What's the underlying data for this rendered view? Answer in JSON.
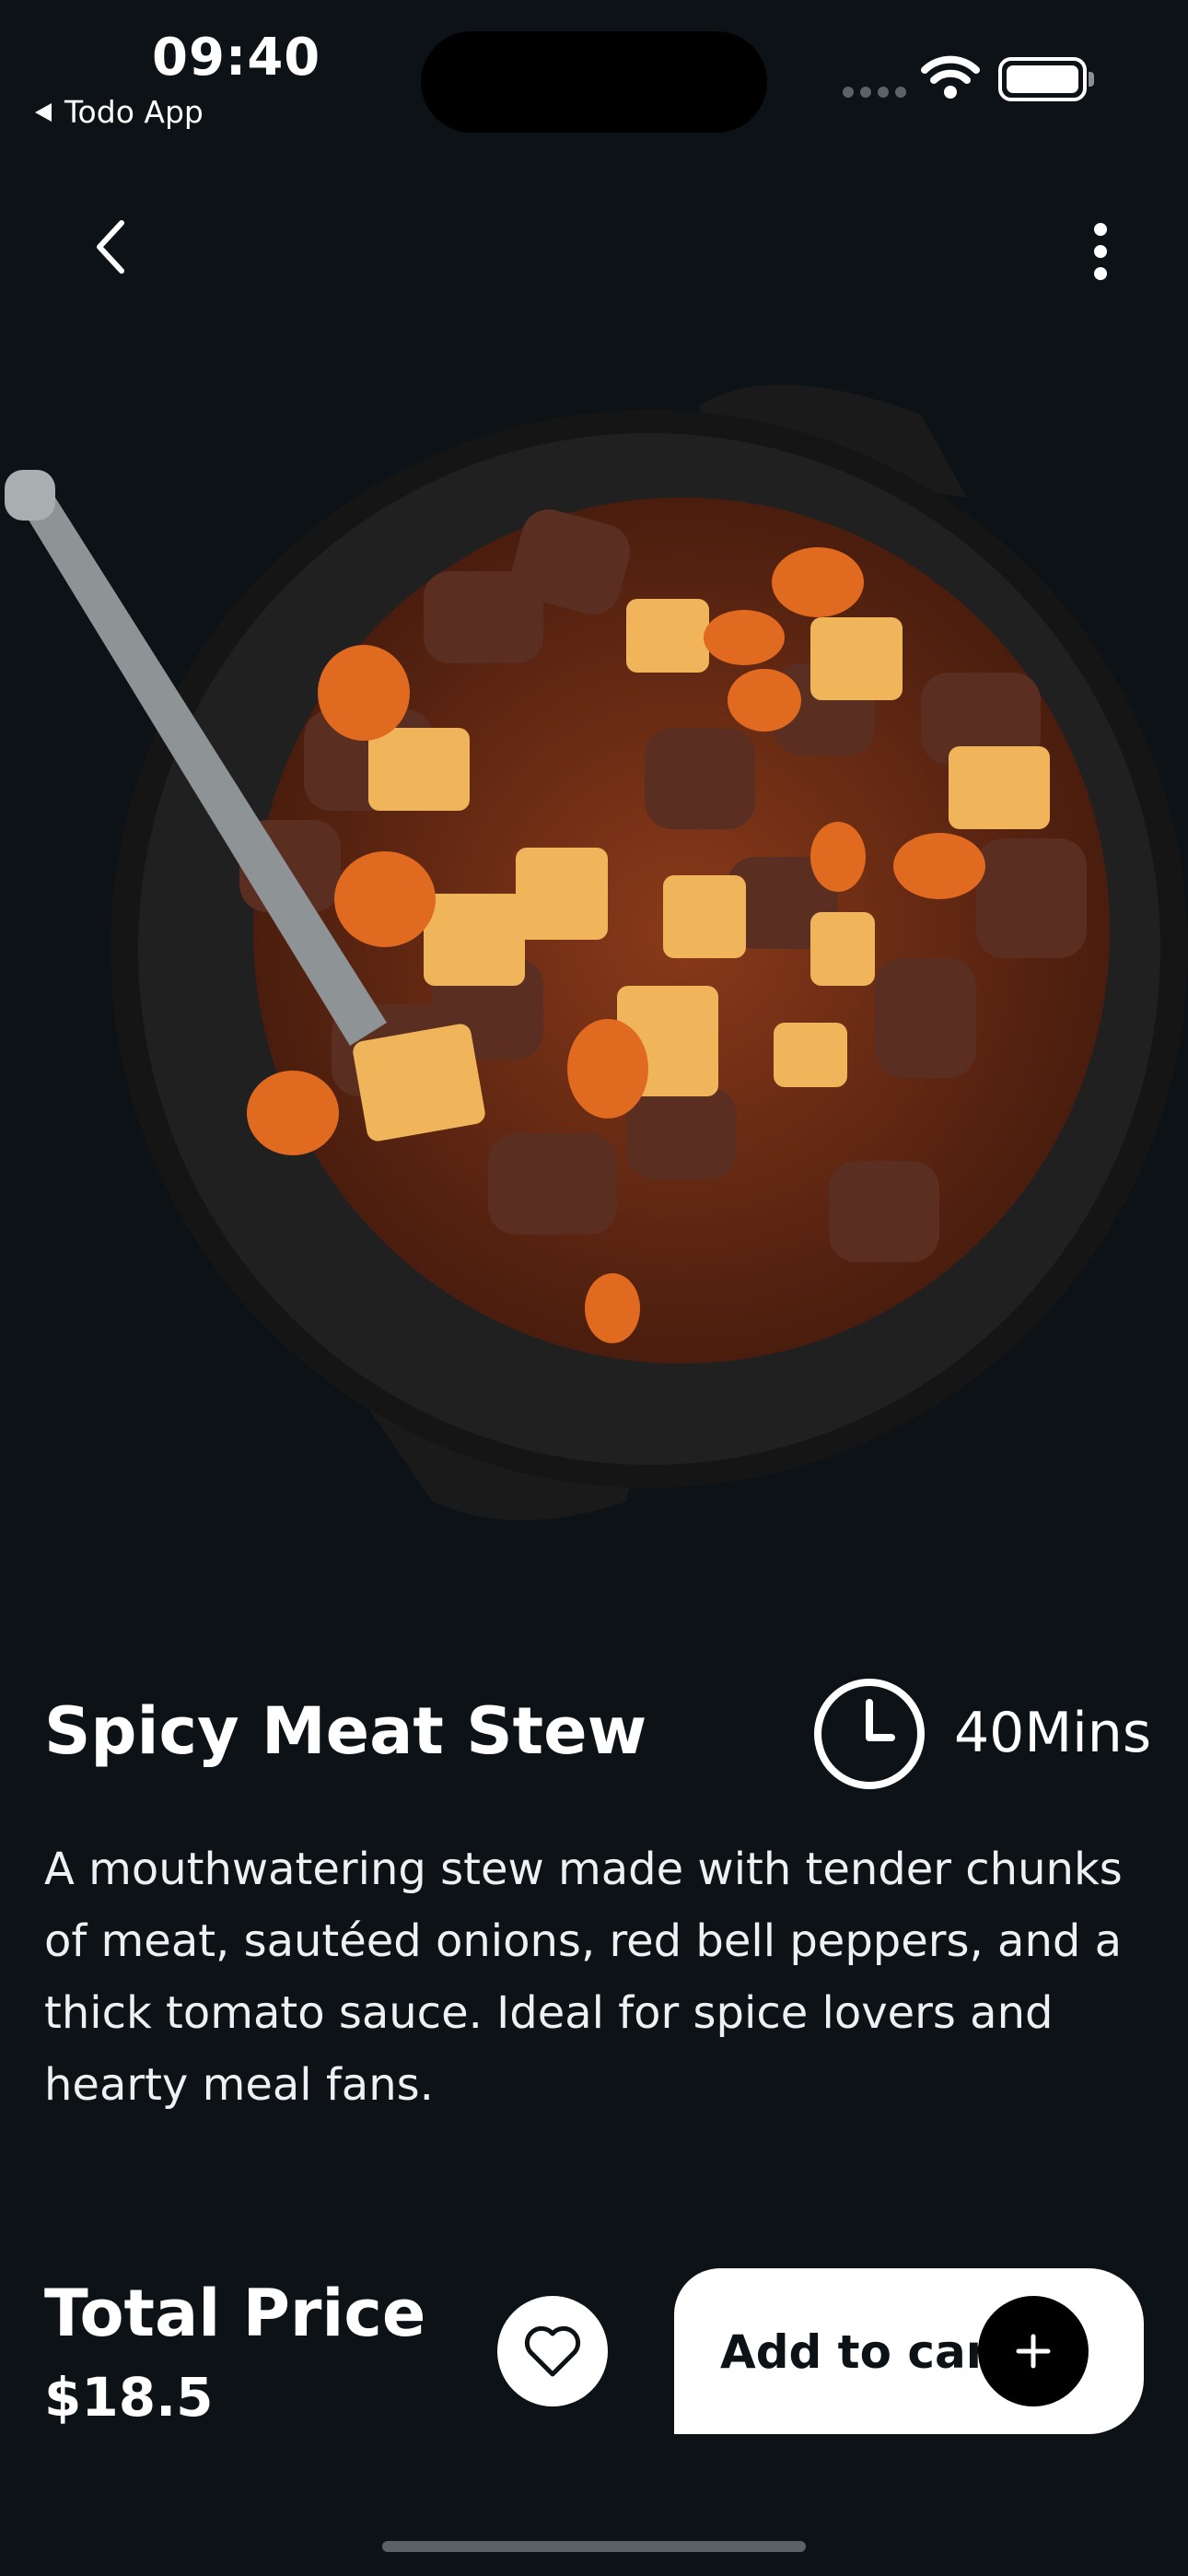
{
  "status_bar": {
    "time": "09:40",
    "back_app": "Todo App"
  },
  "icons": {
    "back": "chevron-left-icon",
    "more": "more-vertical-icon",
    "clock": "clock-icon",
    "favorite": "heart-icon",
    "add": "plus-icon"
  },
  "dish": {
    "name": "Spicy Meat Stew",
    "cook_time": "40Mins",
    "description": "A mouthwatering stew made with tender chunks of meat, sautéed onions, red bell peppers, and a thick tomato sauce. Ideal for spice lovers and hearty meal fans."
  },
  "price": {
    "label": "Total Price",
    "value": "$18.5"
  },
  "actions": {
    "add_to_cart": "Add to cart"
  },
  "colors": {
    "background": "#0d1216",
    "text": "#ffffff",
    "button_bg": "#ffffff",
    "button_icon_bg": "#000000"
  }
}
